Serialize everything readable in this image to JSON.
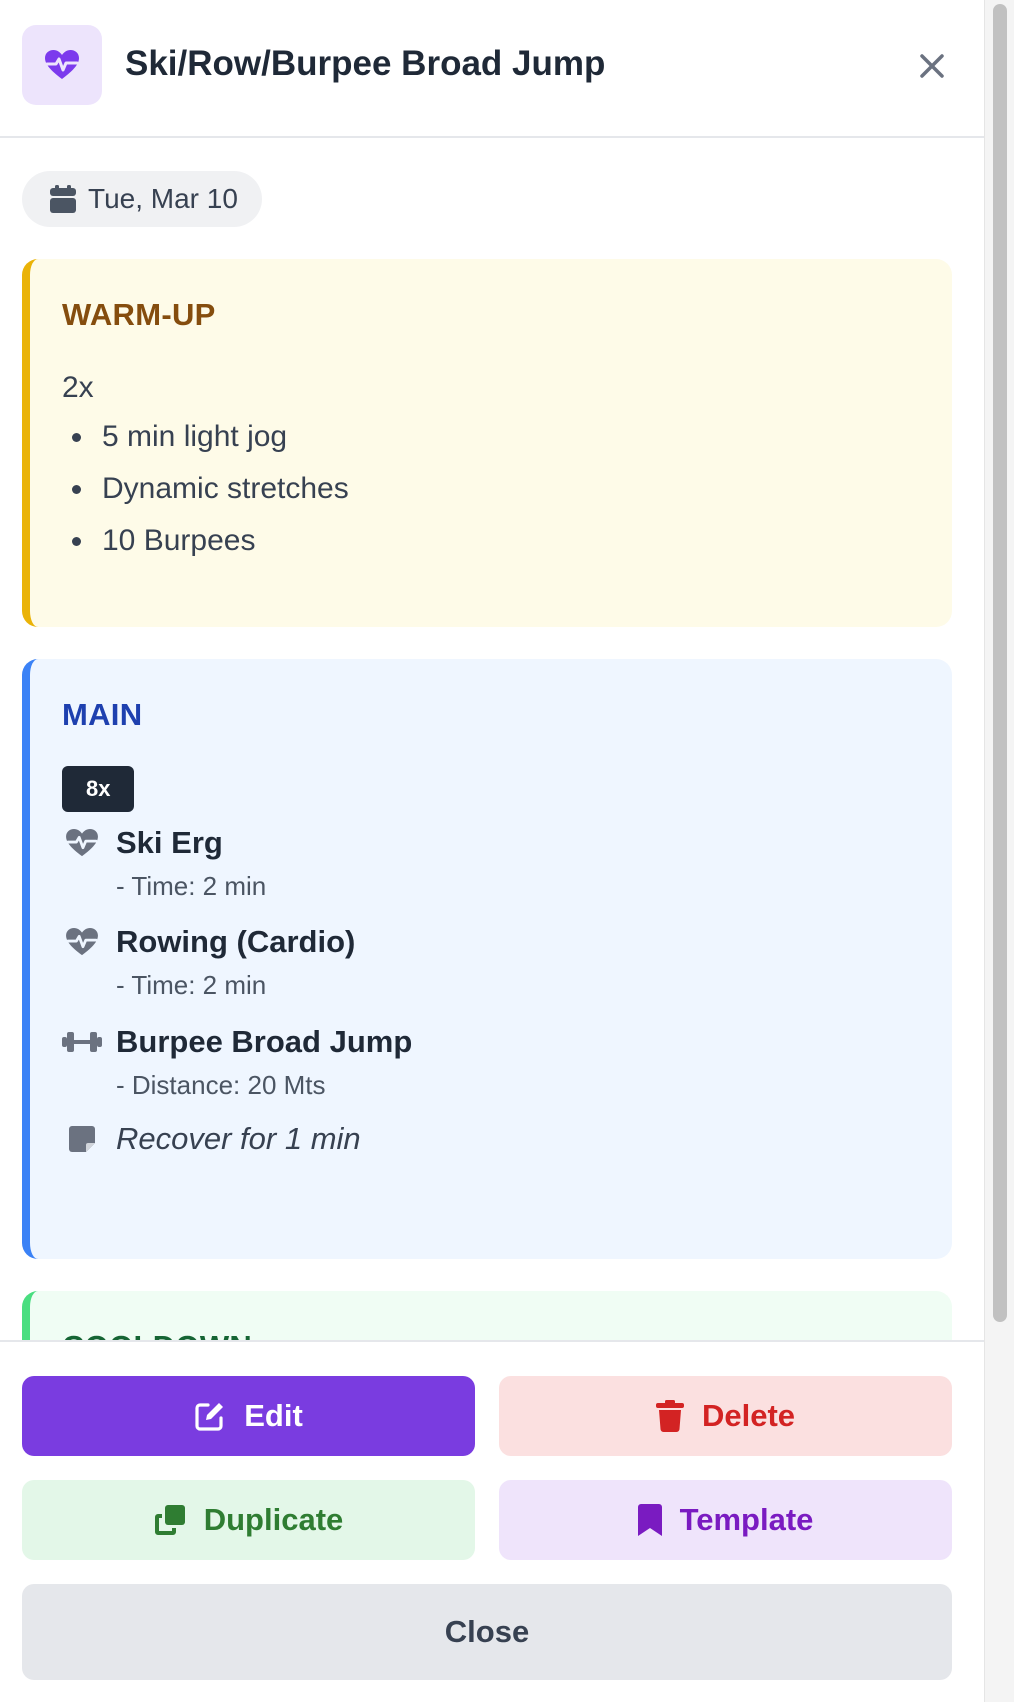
{
  "header": {
    "title": "Ski/Row/Burpee Broad Jump",
    "icon": "heart-pulse-icon",
    "close_icon": "close-icon"
  },
  "date": {
    "icon": "calendar-icon",
    "label": "Tue, Mar 10"
  },
  "sections": {
    "warmup": {
      "title": "WARM-UP",
      "rounds": "2x",
      "items": [
        "5 min light jog",
        "Dynamic stretches",
        "10 Burpees"
      ]
    },
    "main": {
      "title": "MAIN",
      "rounds_badge": "8x",
      "exercises": [
        {
          "icon": "heart-pulse-icon",
          "name": "Ski Erg",
          "detail": "- Time: 2 min"
        },
        {
          "icon": "heart-pulse-icon",
          "name": "Rowing (Cardio)",
          "detail": "- Time: 2 min"
        },
        {
          "icon": "dumbbell-icon",
          "name": "Burpee Broad Jump",
          "detail": "- Distance: 20 Mts"
        }
      ],
      "note": {
        "icon": "note-icon",
        "text": "Recover for 1 min"
      }
    },
    "cooldown": {
      "title": "COOLDOWN"
    }
  },
  "actions": {
    "edit": "Edit",
    "delete": "Delete",
    "duplicate": "Duplicate",
    "template": "Template",
    "close": "Close"
  },
  "colors": {
    "accent": "#7a3ce0",
    "warmup_border": "#eab308",
    "main_border": "#3b82f6",
    "cooldown_border": "#4ade80",
    "delete_text": "#d32323"
  }
}
